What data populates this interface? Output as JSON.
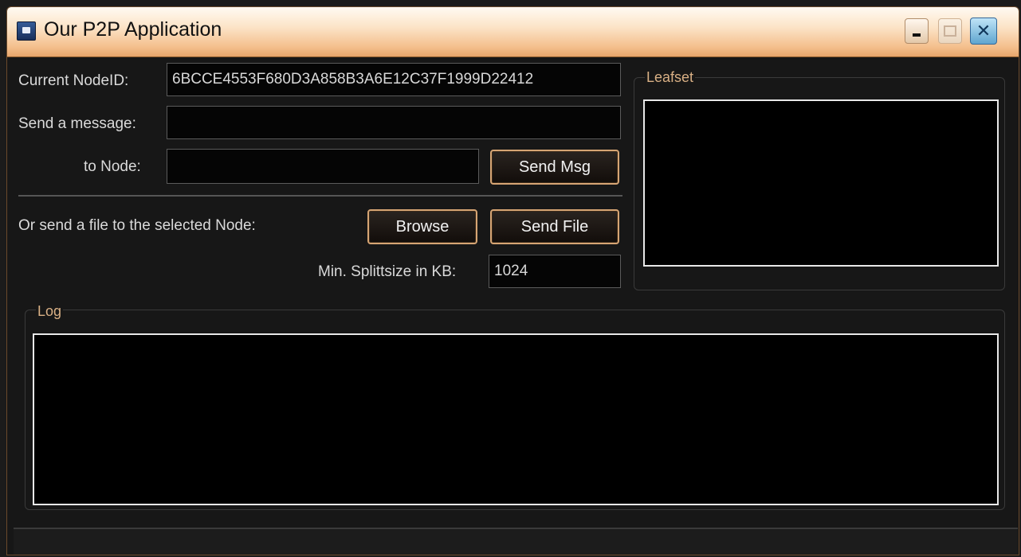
{
  "window": {
    "title": "Our P2P Application",
    "buttons": {
      "minimize": "minimize",
      "maximize": "maximize",
      "close": "✕"
    }
  },
  "form": {
    "node_id_label": "Current NodeID:",
    "node_id_value": "6BCCE4553F680D3A858B3A6E12C37F1999D22412",
    "message_label": "Send a message:",
    "message_value": "",
    "to_node_label": "to Node:",
    "to_node_value": "",
    "send_msg_button": "Send Msg",
    "file_label": "Or send a file to the selected Node:",
    "browse_button": "Browse",
    "send_file_button": "Send File",
    "splitsize_label": "Min. Splittsize in KB:",
    "splitsize_value": "1024"
  },
  "leafset": {
    "title": "Leafset"
  },
  "log": {
    "title": "Log"
  },
  "colors": {
    "accent": "#d6a574",
    "group_label": "#d9b085",
    "background": "#171717"
  }
}
